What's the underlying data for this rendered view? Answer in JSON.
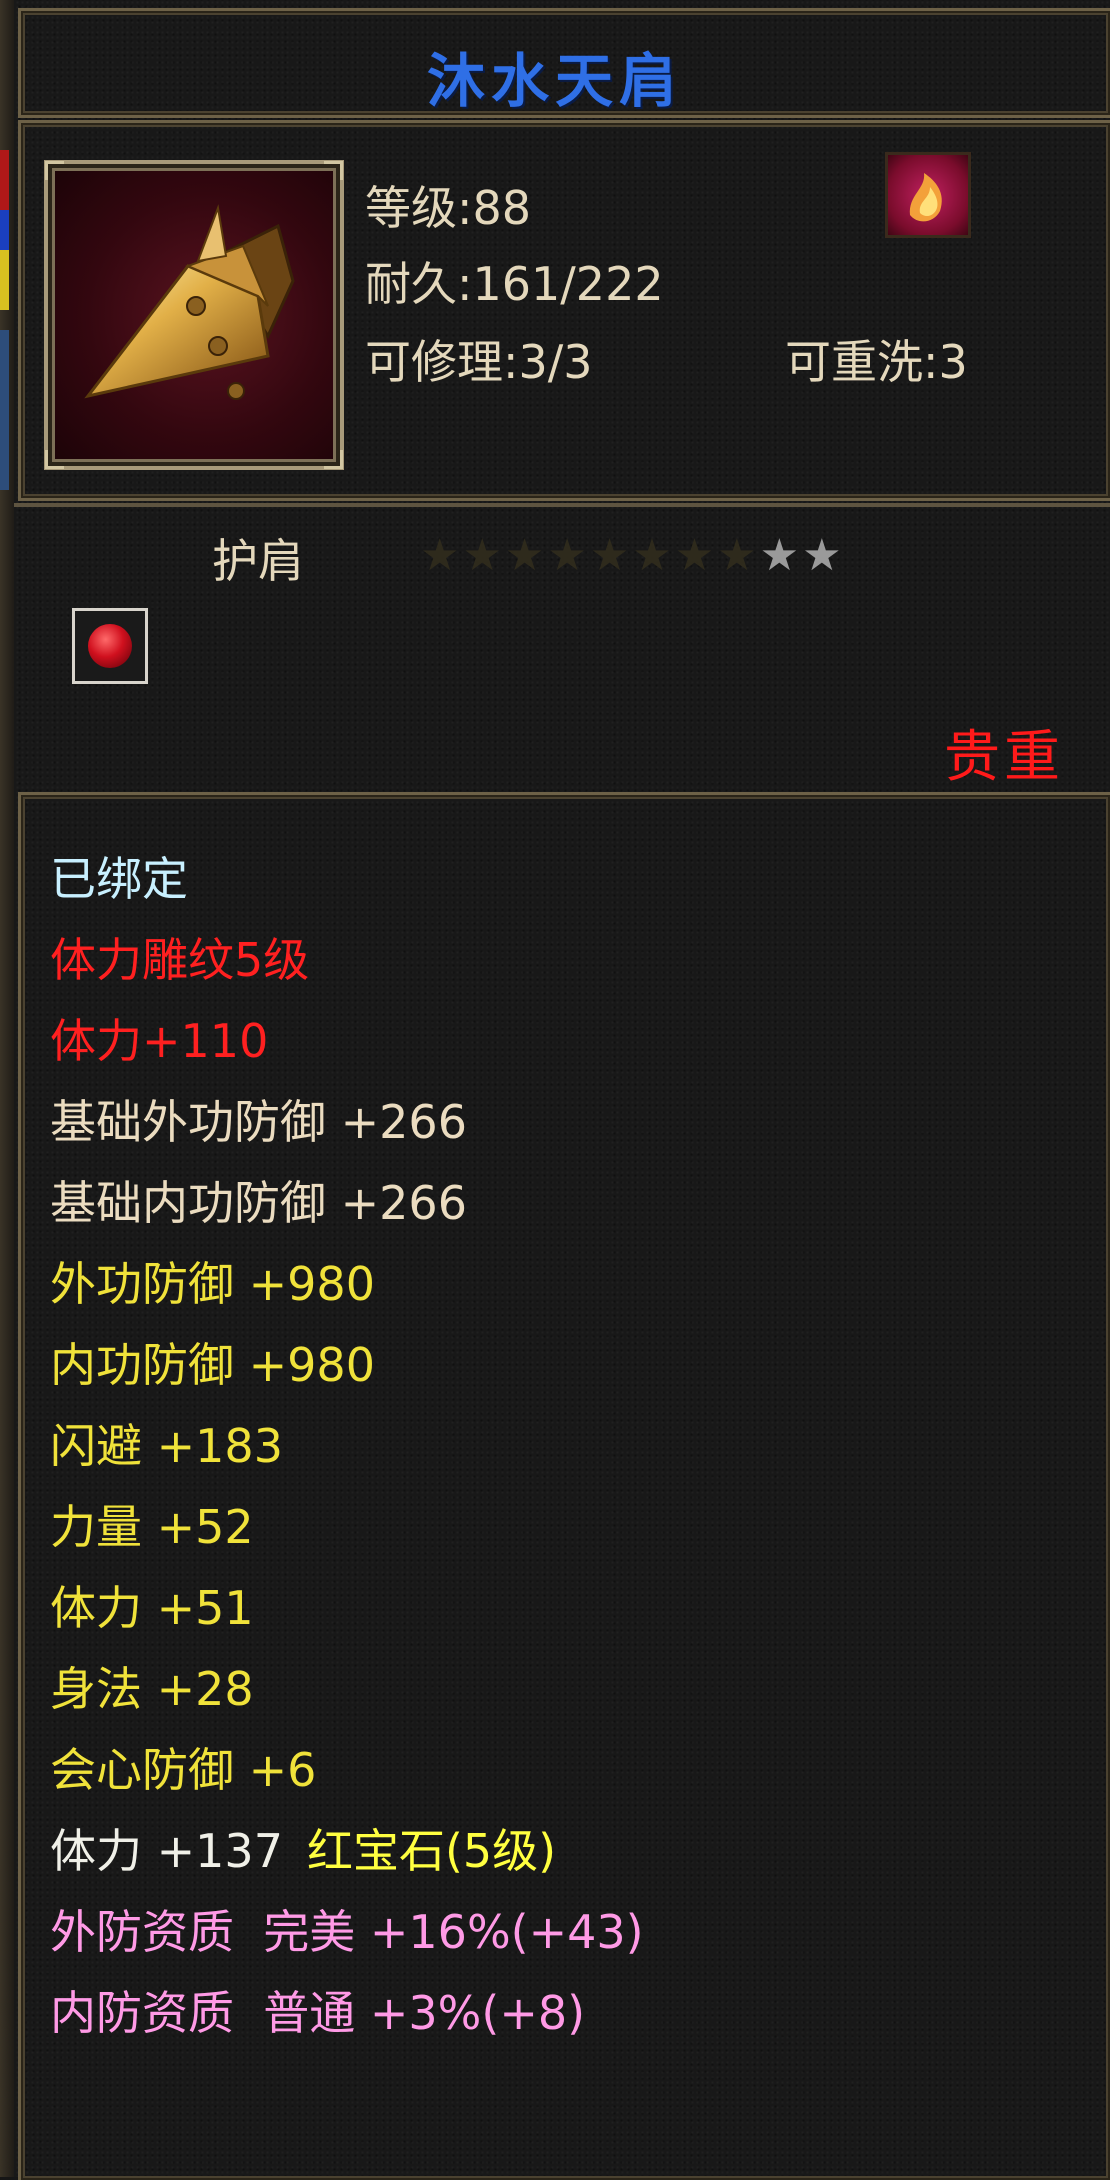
{
  "item": {
    "name": "沐水天肩",
    "level_label": "等级:88",
    "durability_label": "耐久:161/222",
    "repair_label": "可修理:3/3",
    "rewash_label": "可重洗:3",
    "slot_type": "护肩",
    "rarity": "贵重",
    "stars": {
      "total": 10,
      "lit": 2
    },
    "icon": "shoulder-armor-icon",
    "type_icon": "fire-class-icon",
    "gem_icon": "red-gem-icon"
  },
  "stats": [
    {
      "text": "已绑定",
      "color": "#c8f0ff"
    },
    {
      "text": "体力雕纹5级",
      "color": "#ff2020"
    },
    {
      "text": "体力+110",
      "color": "#ff2020"
    },
    {
      "text": "基础外功防御 +266",
      "color": "#ebdcc0"
    },
    {
      "text": "基础内功防御 +266",
      "color": "#ebdcc0"
    },
    {
      "text": "外功防御 +980",
      "color": "#f0e23a"
    },
    {
      "text": "内功防御 +980",
      "color": "#f0e23a"
    },
    {
      "text": "闪避 +183",
      "color": "#f0e23a"
    },
    {
      "text": "力量 +52",
      "color": "#f0e23a"
    },
    {
      "text": "体力 +51",
      "color": "#f0e23a"
    },
    {
      "text": "身法 +28",
      "color": "#f0e23a"
    },
    {
      "text": "会心防御 +6",
      "color": "#f0e23a"
    },
    {
      "text": "体力 +137",
      "extra": "红宝石(5级)",
      "color": "#f0f0e8",
      "extra_color": "#ffff40"
    },
    {
      "text": "外防资质  完美 +16%(+43)",
      "color": "#ff9ae6"
    },
    {
      "text": "内防资质  普通 +3%(+8)",
      "color": "#ff9ae6"
    }
  ]
}
